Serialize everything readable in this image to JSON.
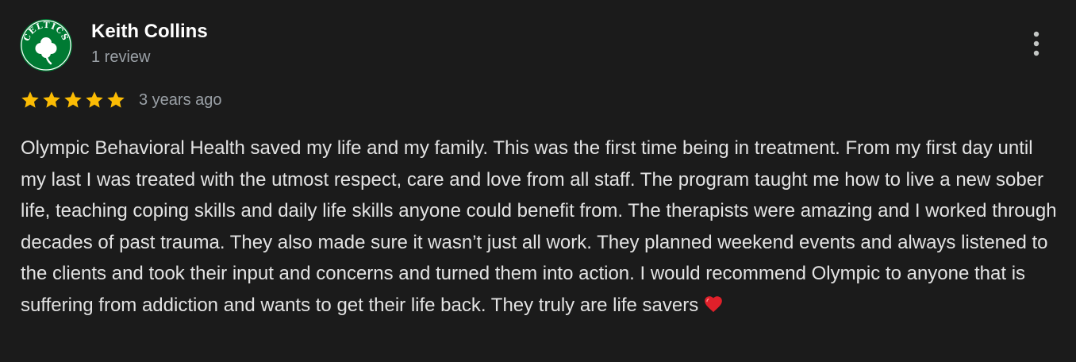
{
  "reviewer": {
    "name": "Keith Collins",
    "review_count": "1 review",
    "avatar_icon": "celtics-shamrock-logo",
    "avatar_text": "CELTICS"
  },
  "menu": {
    "icon": "more-vertical-icon"
  },
  "rating": {
    "stars": 5,
    "max_stars": 5,
    "date": "3 years ago",
    "star_color": "#fbbc04"
  },
  "review": {
    "text": "Olympic Behavioral Health saved my life and my family. This was the first time being in treatment. From my first day until my last I was treated with the utmost respect, care and love from all staff. The program taught me how to live a new sober life, teaching coping skills and daily life skills anyone could benefit from. The therapists were amazing and I worked through decades of past trauma. They also made sure it wasn’t just all work. They planned weekend events and always listened to the clients and took their input and concerns and turned them into action. I would recommend Olympic to anyone that is suffering from addiction and wants to get their life back. They truly are life savers",
    "trailing_emoji": "heart-icon"
  },
  "colors": {
    "background": "#1b1b1b",
    "name": "#ffffff",
    "secondary_text": "#9aa0a6",
    "body_text": "#e3e3e3",
    "avatar_green": "#007a33",
    "heart": "#e0202a"
  }
}
